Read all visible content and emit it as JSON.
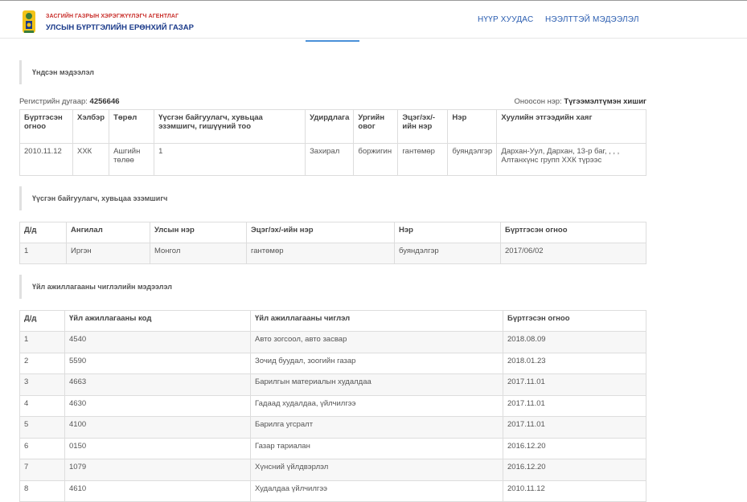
{
  "header": {
    "agency_name": "ЗАСГИЙН ГАЗРЫН ХЭРЭГЖҮҮЛЭГЧ АГЕНТЛАГ",
    "org_name": "УЛСЫН БҮРТГЭЛИЙН ЕРӨНХИЙ ГАЗАР",
    "nav_home": "НҮҮР ХУУДАС",
    "nav_info": "НЭЭЛТТЭЙ МЭДЭЭЛЭЛ"
  },
  "basic": {
    "section_title": "Үндсэн мэдээлэл",
    "reg_label": "Регистрийн дугаар:",
    "reg_value": "4256646",
    "short_name_label": "Оноосон нэр:",
    "short_name_value": "Түгээмэлтүмэн хишиг",
    "headers": [
      "Бүртгэсэн огноо",
      "Хэлбэр",
      "Төрөл",
      "Үүсгэн байгуулагч, хувьцаа эзэмшигч, гишүүний тоо",
      "Удирдлага",
      "Ургийн овог",
      "Эцэг/эх/-ийн нэр",
      "Нэр",
      "Хуулийн этгээдийн хаяг"
    ],
    "row": [
      "2010.11.12",
      "ХХК",
      "Ашгийн төлөө",
      "1",
      "Захирал",
      "боржигин",
      "гантөмөр",
      "буяндэлгэр",
      "Дархан-Уул, Дархан, 13-р баг, , , , Алтанхүнс групп ХХК түрээс"
    ]
  },
  "founders": {
    "section_title": "Үүсгэн байгуулагч, хувьцаа эзэмшигч",
    "headers": [
      "Д/д",
      "Ангилал",
      "Улсын нэр",
      "Эцэг/эх/-ийн нэр",
      "Нэр",
      "Бүртгэсэн огноо"
    ],
    "rows": [
      [
        "1",
        "Иргэн",
        "Монгол",
        "гантөмөр",
        "буяндэлгэр",
        "2017/06/02"
      ]
    ]
  },
  "activities": {
    "section_title": "Үйл ажиллагааны чиглэлийн мэдээлэл",
    "headers": [
      "Д/д",
      "Үйл ажиллагааны код",
      "Үйл ажиллагааны чиглэл",
      "Бүртгэсэн огноо"
    ],
    "rows": [
      [
        "1",
        "4540",
        "Авто зогсоол, авто засвар",
        "2018.08.09"
      ],
      [
        "2",
        "5590",
        "Зочид буудал, зоогийн газар",
        "2018.01.23"
      ],
      [
        "3",
        "4663",
        "Барилгын материалын худалдаа",
        "2017.11.01"
      ],
      [
        "4",
        "4630",
        "Гадаад худалдаа, үйлчилгээ",
        "2017.11.01"
      ],
      [
        "5",
        "4100",
        "Барилга угсралт",
        "2017.11.01"
      ],
      [
        "6",
        "0150",
        "Газар тариалан",
        "2016.12.20"
      ],
      [
        "7",
        "1079",
        "Хүнсний үйлдвэрлэл",
        "2016.12.20"
      ],
      [
        "8",
        "4610",
        "Худалдаа үйлчилгээ",
        "2010.11.12"
      ]
    ]
  }
}
